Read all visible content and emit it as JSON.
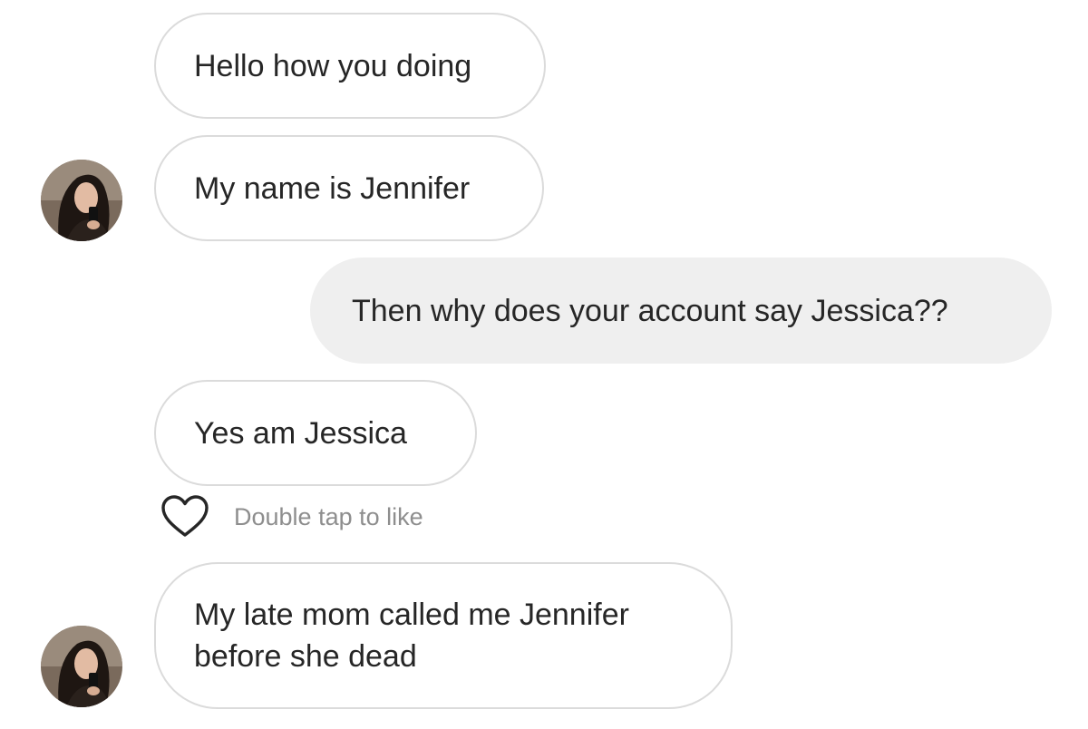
{
  "messages": [
    {
      "side": "incoming",
      "text": "Hello how you doing"
    },
    {
      "side": "incoming",
      "text": "My name is Jennifer"
    },
    {
      "side": "outgoing",
      "text": "Then why does your account say Jessica??"
    },
    {
      "side": "incoming",
      "text": "Yes am Jessica"
    },
    {
      "side": "incoming",
      "text": "My late mom called me Jennifer before she dead"
    }
  ],
  "like_hint": "Double tap to like",
  "icons": {
    "like": "heart-outline-icon",
    "avatar": "profile-photo"
  },
  "colors": {
    "incoming_border": "#dbdbdb",
    "outgoing_background": "#efefef",
    "text": "#262626",
    "hint_text": "#8e8e8e"
  }
}
